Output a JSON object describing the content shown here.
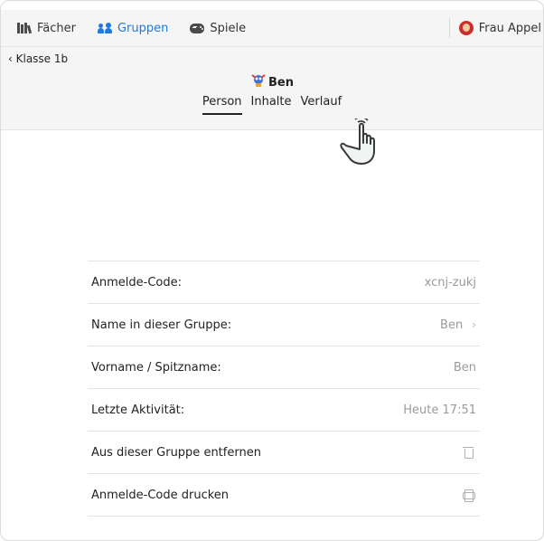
{
  "topbar": {
    "items": [
      {
        "label": "Fächer"
      },
      {
        "label": "Gruppen"
      },
      {
        "label": "Spiele"
      }
    ],
    "user_label": "Frau Appel"
  },
  "header": {
    "back_label": "‹ Klasse 1b",
    "student_name": "Ben",
    "tabs": [
      {
        "label": "Person"
      },
      {
        "label": "Inhalte"
      },
      {
        "label": "Verlauf"
      }
    ]
  },
  "details": {
    "rows": [
      {
        "label": "Anmelde-Code:",
        "value": "xcnj-zukj"
      },
      {
        "label": "Name in dieser Gruppe:",
        "value": "Ben"
      },
      {
        "label": "Vorname / Spitzname:",
        "value": "Ben"
      },
      {
        "label": "Letzte Aktivität:",
        "value": "Heute 17:51"
      },
      {
        "label": "Aus dieser Gruppe entfernen"
      },
      {
        "label": "Anmelde-Code drucken"
      }
    ]
  },
  "colors": {
    "accent": "#1f7ae0",
    "background": "#f5f5f5"
  },
  "icons": {
    "faecher": "books-icon",
    "gruppen": "group-icon",
    "spiele": "gamepad-icon",
    "user": "avatar-icon",
    "chevron": "chevron-right-icon",
    "remove": "trash-icon",
    "print": "printer-icon",
    "cursor": "hand-pointer-icon"
  }
}
